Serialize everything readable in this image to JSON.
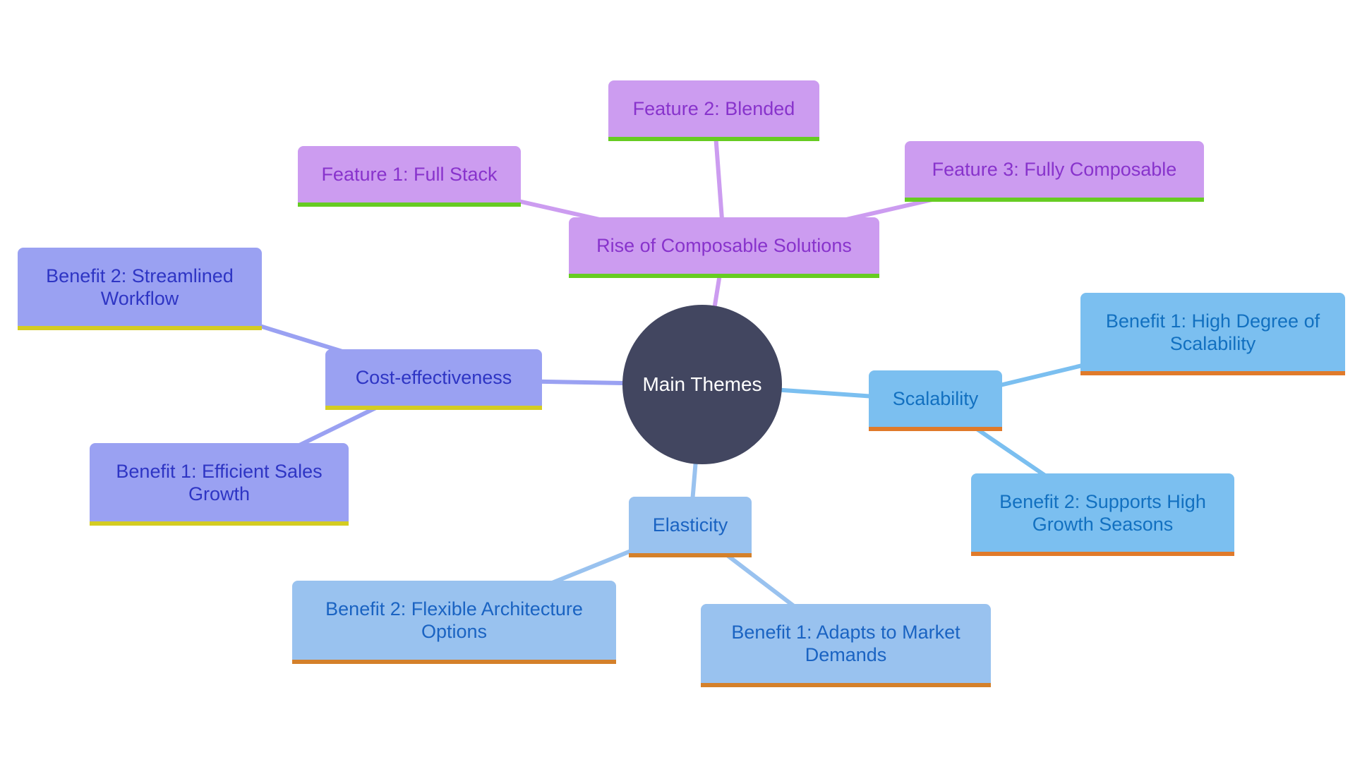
{
  "diagram": {
    "type": "mindmap",
    "root": {
      "id": "root",
      "label": "Main Themes",
      "color": "#424660"
    },
    "branches": [
      {
        "id": "composable",
        "label": "Rise of Composable Solutions",
        "theme": "purple",
        "fill": "#cc9cf0",
        "accent": "#66cc22",
        "edge": "#cc9cf0",
        "children": [
          {
            "id": "f1",
            "label": "Feature 1: Full Stack"
          },
          {
            "id": "f2",
            "label": "Feature 2: Blended"
          },
          {
            "id": "f3",
            "label": "Feature 3: Fully Composable"
          }
        ]
      },
      {
        "id": "cost",
        "label": "Cost-effectiveness",
        "theme": "indigo",
        "fill": "#9aa1f2",
        "accent": "#d4cc22",
        "edge": "#9aa1f2",
        "children": [
          {
            "id": "c2",
            "label": "Benefit 2: Streamlined Workflow"
          },
          {
            "id": "c1",
            "label": "Benefit 1: Efficient Sales Growth"
          }
        ]
      },
      {
        "id": "scal",
        "label": "Scalability",
        "theme": "sky",
        "fill": "#7bbff0",
        "accent": "#e07a2a",
        "edge": "#7bbff0",
        "children": [
          {
            "id": "s1",
            "label": "Benefit 1: High Degree of Scalability"
          },
          {
            "id": "s2",
            "label": "Benefit 2: Supports High Growth Seasons"
          }
        ]
      },
      {
        "id": "elas",
        "label": "Elasticity",
        "theme": "pale",
        "fill": "#99c2ef",
        "accent": "#d4802a",
        "edge": "#99c2ef",
        "children": [
          {
            "id": "e2",
            "label": "Benefit 2: Flexible Architecture Options"
          },
          {
            "id": "e1",
            "label": "Benefit 1: Adapts to Market Demands"
          }
        ]
      }
    ]
  }
}
